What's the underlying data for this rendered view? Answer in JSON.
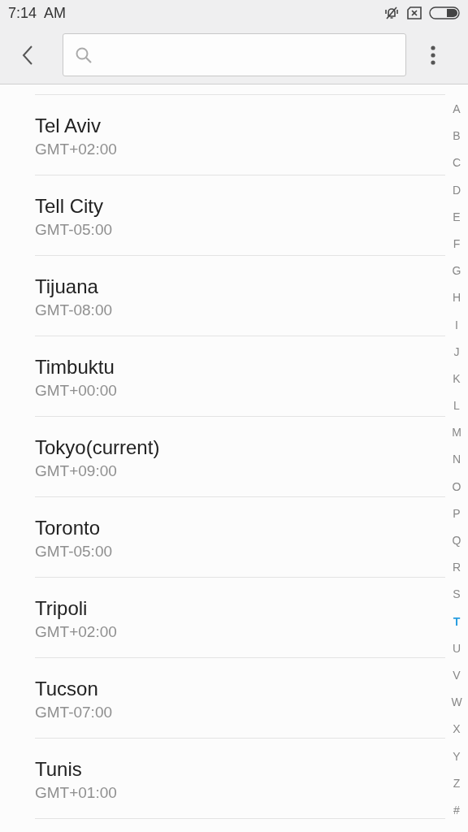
{
  "status_bar": {
    "time": "7:14  AM"
  },
  "cities": [
    {
      "name": "Tel Aviv",
      "offset": "GMT+02:00"
    },
    {
      "name": "Tell City",
      "offset": "GMT-05:00"
    },
    {
      "name": "Tijuana",
      "offset": "GMT-08:00"
    },
    {
      "name": "Timbuktu",
      "offset": "GMT+00:00"
    },
    {
      "name": "Tokyo(current)",
      "offset": "GMT+09:00"
    },
    {
      "name": "Toronto",
      "offset": "GMT-05:00"
    },
    {
      "name": "Tripoli",
      "offset": "GMT+02:00"
    },
    {
      "name": "Tucson",
      "offset": "GMT-07:00"
    },
    {
      "name": "Tunis",
      "offset": "GMT+01:00"
    }
  ],
  "index": [
    {
      "letter": "A",
      "selected": false
    },
    {
      "letter": "B",
      "selected": false
    },
    {
      "letter": "C",
      "selected": false
    },
    {
      "letter": "D",
      "selected": false
    },
    {
      "letter": "E",
      "selected": false
    },
    {
      "letter": "F",
      "selected": false
    },
    {
      "letter": "G",
      "selected": false
    },
    {
      "letter": "H",
      "selected": false
    },
    {
      "letter": "I",
      "selected": false
    },
    {
      "letter": "J",
      "selected": false
    },
    {
      "letter": "K",
      "selected": false
    },
    {
      "letter": "L",
      "selected": false
    },
    {
      "letter": "M",
      "selected": false
    },
    {
      "letter": "N",
      "selected": false
    },
    {
      "letter": "O",
      "selected": false
    },
    {
      "letter": "P",
      "selected": false
    },
    {
      "letter": "Q",
      "selected": false
    },
    {
      "letter": "R",
      "selected": false
    },
    {
      "letter": "S",
      "selected": false
    },
    {
      "letter": "T",
      "selected": true
    },
    {
      "letter": "U",
      "selected": false
    },
    {
      "letter": "V",
      "selected": false
    },
    {
      "letter": "W",
      "selected": false
    },
    {
      "letter": "X",
      "selected": false
    },
    {
      "letter": "Y",
      "selected": false
    },
    {
      "letter": "Z",
      "selected": false
    },
    {
      "letter": "#",
      "selected": false
    }
  ]
}
